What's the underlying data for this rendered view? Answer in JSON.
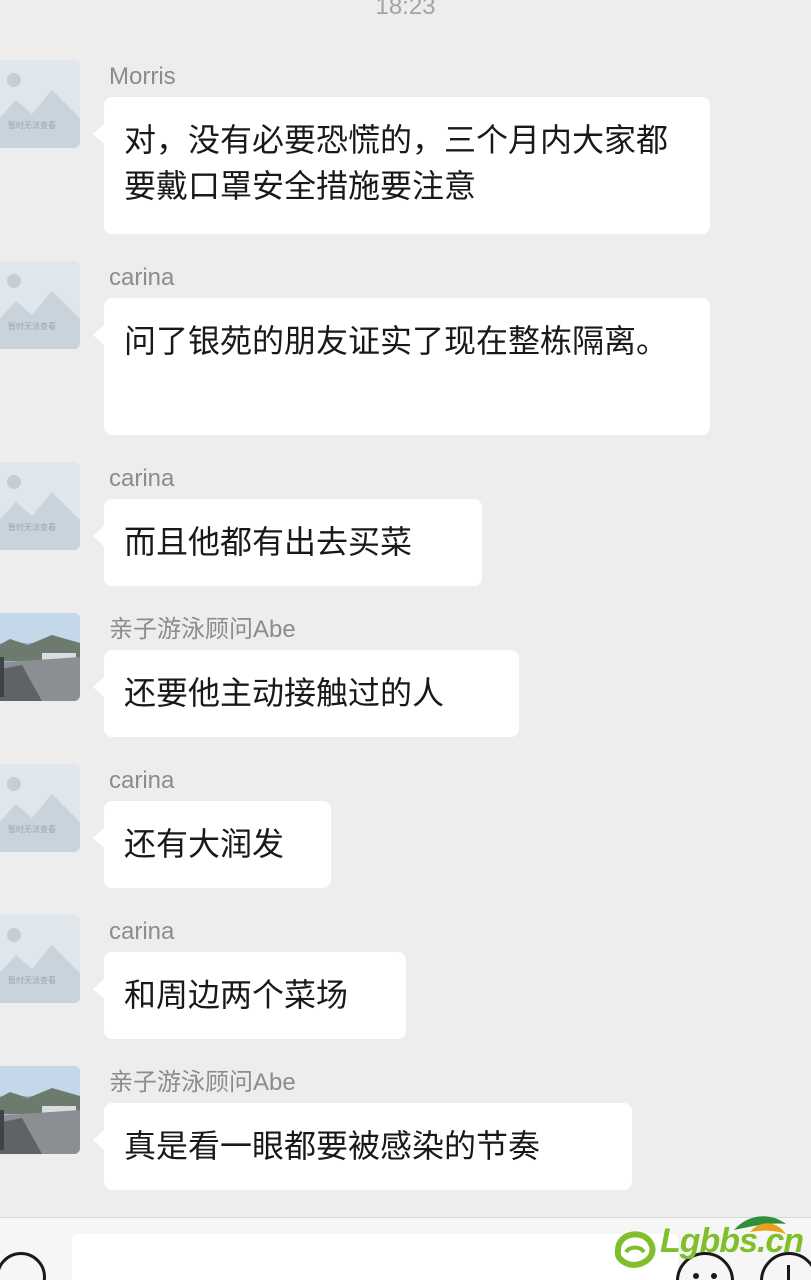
{
  "timestamp": "18:23",
  "avatar_placeholder_caption": "暂时无法查看",
  "messages": [
    {
      "sender": "Morris",
      "avatar": "placeholder",
      "text": "对，没有必要恐慌的，三个月内大家都要戴口罩安全措施要注意"
    },
    {
      "sender": "carina",
      "avatar": "placeholder",
      "text": "问了银苑的朋友证实了现在整栋隔离。"
    },
    {
      "sender": "carina",
      "avatar": "placeholder",
      "text": "而且他都有出去买菜"
    },
    {
      "sender": "亲子游泳顾问Abe",
      "avatar": "photo",
      "text": "还要他主动接触过的人"
    },
    {
      "sender": "carina",
      "avatar": "placeholder",
      "text": "还有大润发"
    },
    {
      "sender": "carina",
      "avatar": "placeholder",
      "text": "和周边两个菜场"
    },
    {
      "sender": "亲子游泳顾问Abe",
      "avatar": "photo",
      "text": "真是看一眼都要被感染的节奏"
    }
  ],
  "input_bar": {
    "voice_icon": "voice-icon",
    "emoji_icon": "emoji-icon",
    "plus_icon": "plus-icon"
  },
  "watermark": {
    "text": "Lgbbs.cn",
    "color": "#7fbf2a"
  }
}
